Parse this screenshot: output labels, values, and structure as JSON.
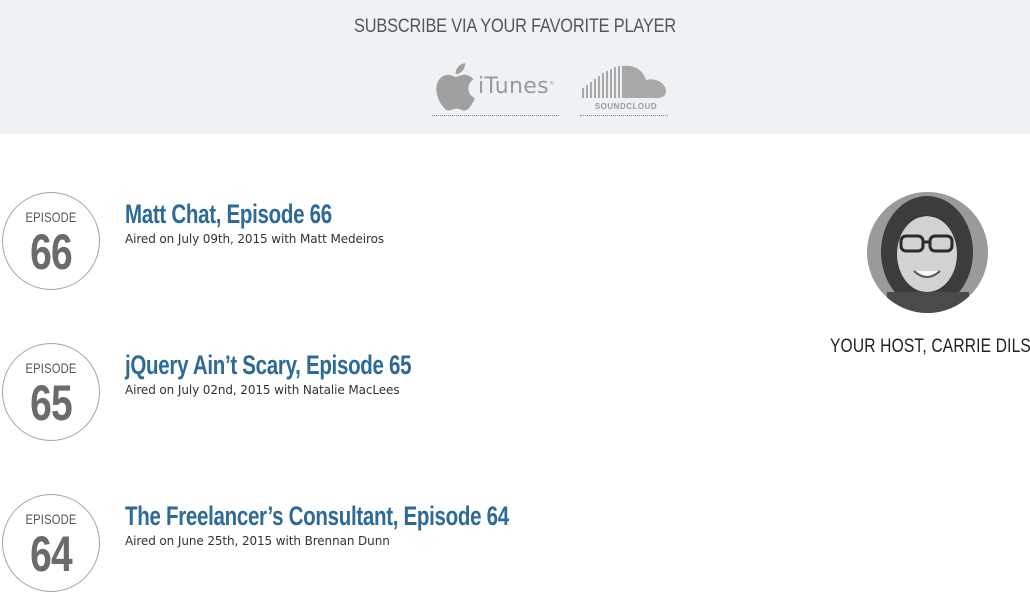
{
  "subscribe": {
    "title": "SUBSCRIBE VIA YOUR FAVORITE PLAYER",
    "itunes_label": "iTunes",
    "itunes_tm": "®",
    "soundcloud_label": "SOUNDCLOUD"
  },
  "episodes": [
    {
      "badge_label": "EPISODE",
      "number": "66",
      "title": "Matt Chat, Episode 66",
      "meta": "Aired on July 09th, 2015 with Matt Medeiros"
    },
    {
      "badge_label": "EPISODE",
      "number": "65",
      "title": "jQuery Ain’t Scary, Episode 65",
      "meta": "Aired on July 02nd, 2015 with Natalie MacLees"
    },
    {
      "badge_label": "EPISODE",
      "number": "64",
      "title": "The Freelancer’s Consultant, Episode 64",
      "meta": "Aired on June 25th, 2015 with Brennan Dunn"
    }
  ],
  "host": {
    "label": "YOUR HOST, CARRIE DILS"
  },
  "colors": {
    "accent": "#2d6a95",
    "subscribe_bg": "#eef2f5",
    "badge_border": "#a5a5a5"
  }
}
